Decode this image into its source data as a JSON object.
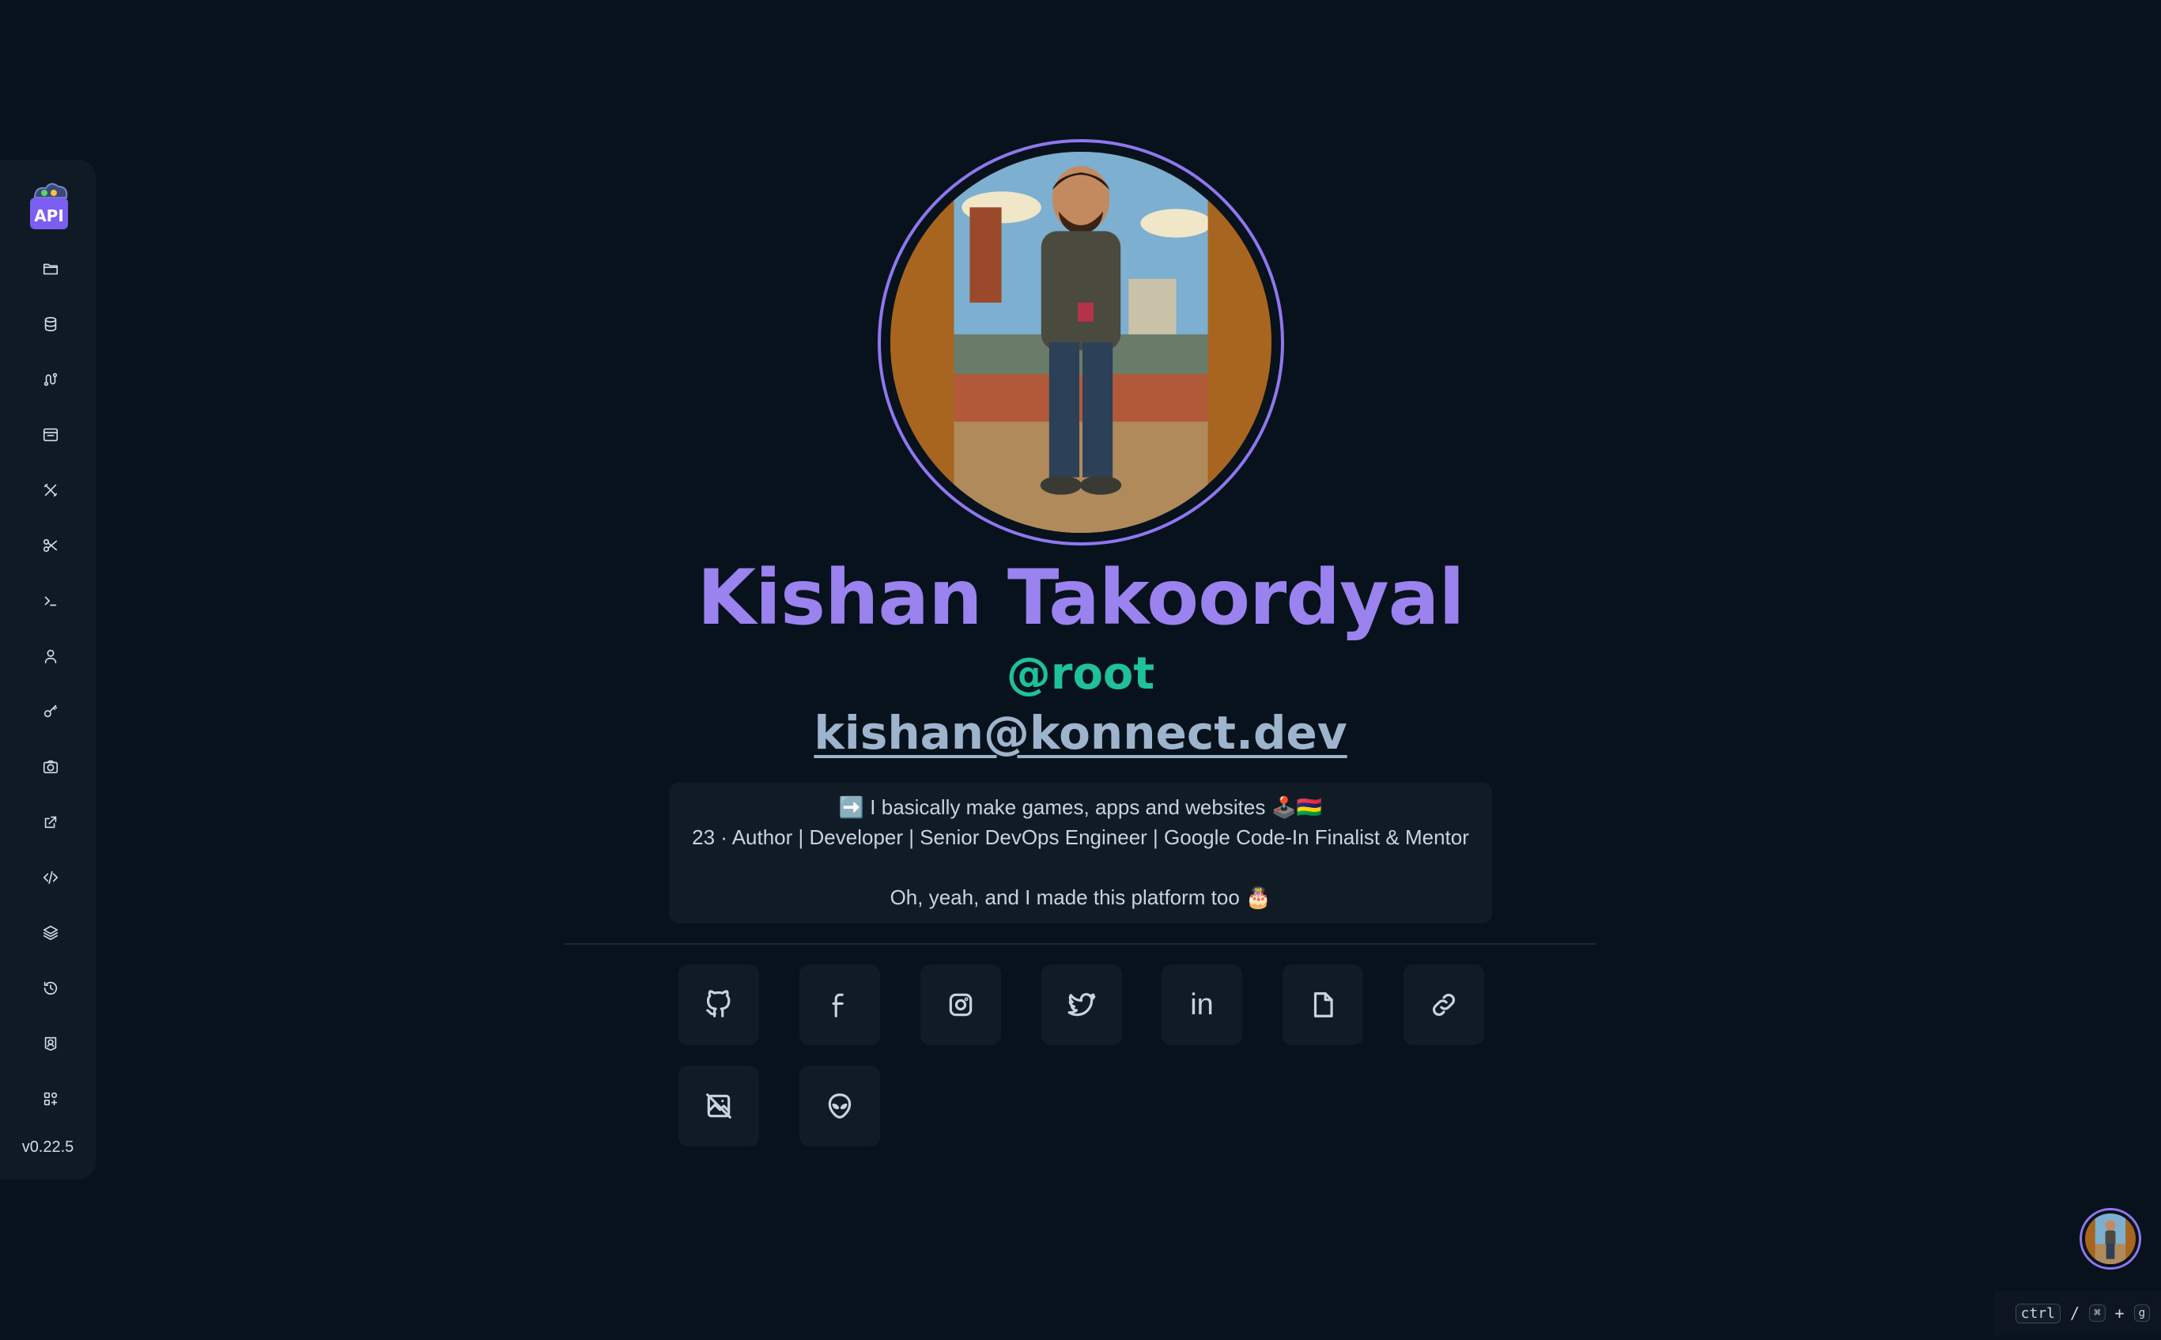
{
  "sidebar": {
    "logo_text": "API",
    "items": [
      {
        "icon": "folder-icon"
      },
      {
        "icon": "database-icon"
      },
      {
        "icon": "route-icon"
      },
      {
        "icon": "browser-window-icon"
      },
      {
        "icon": "tools-icon"
      },
      {
        "icon": "scissors-icon"
      },
      {
        "icon": "terminal-icon"
      },
      {
        "icon": "user-icon"
      },
      {
        "icon": "key-icon"
      },
      {
        "icon": "camera-icon"
      },
      {
        "icon": "external-link-icon"
      },
      {
        "icon": "code-icon"
      },
      {
        "icon": "layers-icon"
      },
      {
        "icon": "history-icon"
      },
      {
        "icon": "user-badge-icon"
      },
      {
        "icon": "apps-icon"
      }
    ],
    "version": "v0.22.5"
  },
  "profile": {
    "name": "Kishan Takoordyal",
    "handle": "@root",
    "email": "kishan@konnect.dev",
    "bio": {
      "line1": "➡️ I basically make games, apps and websites 🕹️🇲🇺",
      "line2": "23 · Author | Developer | Senior DevOps Engineer | Google Code-In Finalist & Mentor",
      "line3": "Oh, yeah, and I made this platform too 🎂"
    }
  },
  "socials": [
    {
      "icon": "github-icon"
    },
    {
      "icon": "facebook-icon"
    },
    {
      "icon": "instagram-icon"
    },
    {
      "icon": "twitter-icon"
    },
    {
      "icon": "linkedin-icon",
      "text": "in"
    },
    {
      "icon": "document-icon"
    },
    {
      "icon": "link-icon"
    },
    {
      "icon": "photo-off-icon"
    },
    {
      "icon": "alien-icon"
    }
  ],
  "shortcut": {
    "key1": "ctrl",
    "sep": "/",
    "key2": "⌘",
    "plus": "+",
    "key3": "g"
  },
  "colors": {
    "background": "#08121c",
    "accent_purple": "#9a82ef",
    "accent_green": "#1fc19a",
    "email": "#9db4cc",
    "card": "#111b26"
  }
}
